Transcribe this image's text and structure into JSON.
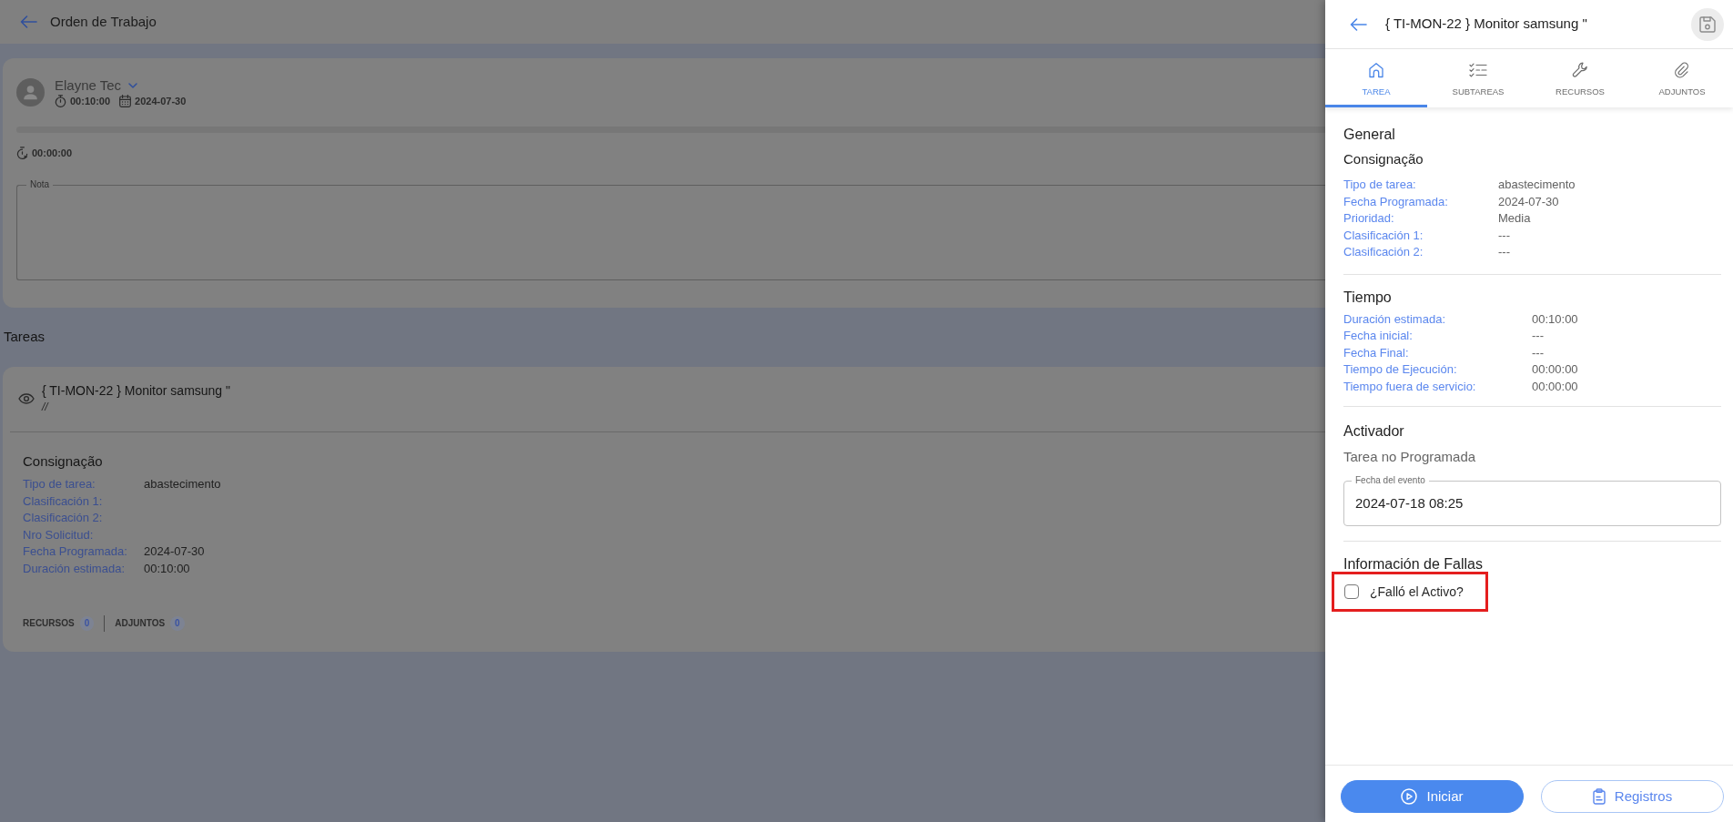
{
  "header": {
    "title": "Orden de Trabajo"
  },
  "assignment": {
    "assignee": "Elayne Tec",
    "duration": "00:10:00",
    "date": "2024-07-30",
    "progress": {
      "level": 0
    },
    "timer": "00:00:00",
    "note": {
      "label": "Nota"
    }
  },
  "tasks": {
    "heading": "Tareas",
    "task": {
      "title": "{ TI-MON-22 } Monitor samsung \"",
      "subtitle": "//",
      "section": "Consignação",
      "fields": [
        {
          "label": "Tipo de tarea:",
          "value": "abastecimento"
        },
        {
          "label": "Clasificación 1:"
        },
        {
          "label": "Clasificación 2:"
        },
        {
          "label": "Nro Solicitud:"
        },
        {
          "label": "Fecha Programada:",
          "value": "2024-07-30"
        },
        {
          "label": "Duración estimada:",
          "value": "00:10:00"
        }
      ],
      "counters": [
        {
          "label": "RECURSOS",
          "count": "0"
        },
        {
          "label": "ADJUNTOS",
          "count": "0"
        }
      ]
    }
  },
  "drawer": {
    "title": "{ TI-MON-22 } Monitor samsung \"",
    "tabs": [
      {
        "label": "TAREA",
        "selected": true
      },
      {
        "label": "SUBTAREAS",
        "selected": false
      },
      {
        "label": "RECURSOS",
        "selected": false
      },
      {
        "label": "ADJUNTOS",
        "selected": false
      }
    ],
    "general": {
      "heading": "General",
      "subheading": "Consignação",
      "fields": [
        {
          "label": "Tipo de tarea:",
          "value": "abastecimento"
        },
        {
          "label": "Fecha Programada:",
          "value": "2024-07-30"
        },
        {
          "label": "Prioridad:",
          "value": "Media"
        },
        {
          "label": "Clasificación 1:",
          "value": "---"
        },
        {
          "label": "Clasificación 2:",
          "value": "---"
        }
      ]
    },
    "time": {
      "heading": "Tiempo",
      "fields": [
        {
          "label": "Duración estimada:",
          "value": "00:10:00"
        },
        {
          "label": "Fecha inicial:",
          "value": "---"
        },
        {
          "label": "Fecha Final:",
          "value": "---"
        },
        {
          "label": "Tiempo de Ejecución:",
          "value": "00:00:00"
        },
        {
          "label": "Tiempo fuera de servicio:",
          "value": "00:00:00"
        }
      ]
    },
    "trigger": {
      "heading": "Activador",
      "text": "Tarea no Programada",
      "event_field": {
        "label": "Fecha del evento",
        "value": "2024-07-18 08:25"
      }
    },
    "failure": {
      "heading": "Información de Fallas",
      "checkbox": {
        "label": "¿Falló el Activo?",
        "checked": false,
        "highlighted": true
      }
    },
    "buttons": [
      {
        "label": "Iniciar",
        "kind": "primary"
      },
      {
        "label": "Registros",
        "kind": "outline"
      }
    ]
  }
}
